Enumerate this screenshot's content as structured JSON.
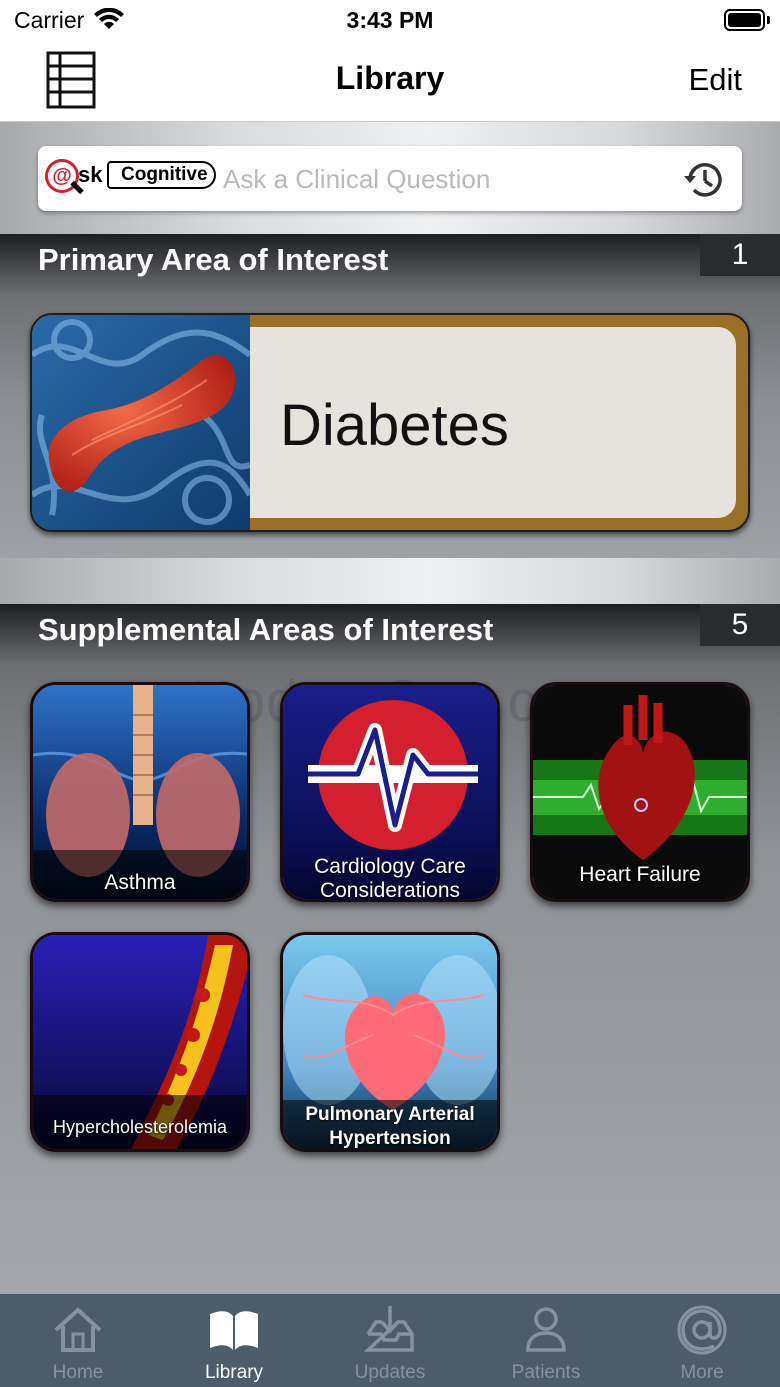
{
  "status_bar": {
    "carrier": "Carrier",
    "time": "3:43 PM"
  },
  "nav": {
    "title": "Library",
    "edit_label": "Edit"
  },
  "search": {
    "logo_at": "@",
    "logo_sk": "sk",
    "logo_cognitive": "Cognitive",
    "placeholder": "Ask a Clinical Question"
  },
  "primary": {
    "title": "Primary Area of Interest",
    "count": "1",
    "card_label": "Diabetes"
  },
  "supplemental": {
    "title": "Supplemental Areas of Interest",
    "count": "5",
    "watermark": "UpdateStar.com",
    "tiles": [
      {
        "label": "Asthma"
      },
      {
        "label_line1": "Cardiology Care",
        "label_line2": "Considerations"
      },
      {
        "label": "Heart Failure"
      },
      {
        "label": "Hypercholesterolemia"
      },
      {
        "label_line1": "Pulmonary Arterial",
        "label_line2": "Hypertension"
      }
    ]
  },
  "tab_bar": {
    "items": [
      {
        "label": "Home",
        "icon": "home-icon"
      },
      {
        "label": "Library",
        "icon": "book-icon",
        "active": true
      },
      {
        "label": "Updates",
        "icon": "inbox-download-icon"
      },
      {
        "label": "Patients",
        "icon": "person-icon"
      },
      {
        "label": "More",
        "icon": "at-sign-icon"
      }
    ]
  },
  "colors": {
    "tab_bar_bg": "#4d5c6b",
    "tab_active": "#ffffff",
    "tab_inactive": "#8593a0",
    "primary_card_border": "#9a7028"
  }
}
